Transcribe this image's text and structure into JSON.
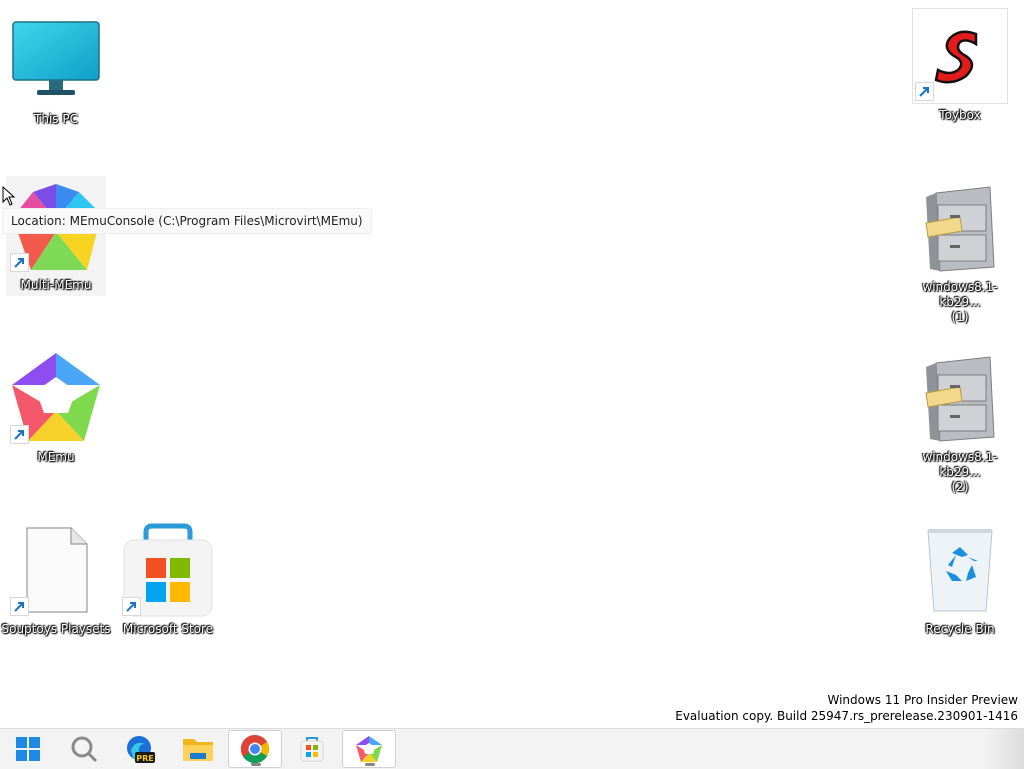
{
  "desktop": {
    "icons": {
      "this_pc": "This PC",
      "multi_memu": "Multi-MEmu",
      "memu": "MEmu",
      "souptoys_playsets": "Souptoys Playsets",
      "microsoft_store": "Microsoft Store",
      "toybox": "Toybox",
      "kb_1_line1": "windows8.1-kb29...",
      "kb_1_line2": "(1)",
      "kb_2_line1": "windows8.1-kb29...",
      "kb_2_line2": "(2)",
      "recycle_bin": "Recycle Bin"
    },
    "tooltip": "Location: MEmuConsole (C:\\Program Files\\Microvirt\\MEmu)"
  },
  "watermark": {
    "line1": "Windows 11 Pro Insider Preview",
    "line2": "Evaluation copy. Build 25947.rs_prerelease.230901-1416"
  },
  "taskbar": {
    "items": [
      {
        "icon": "windows-start-icon"
      },
      {
        "icon": "search-icon"
      },
      {
        "icon": "edge-preview-icon",
        "badge": "PRE"
      },
      {
        "icon": "file-explorer-icon"
      },
      {
        "icon": "chrome-icon"
      },
      {
        "icon": "microsoft-store-icon"
      },
      {
        "icon": "memu-icon"
      }
    ]
  },
  "colors": {
    "desktop_bg": "#ffffff",
    "taskbar_bg": "#f3f3f3",
    "shortcut_arrow": "#1a73c8"
  }
}
